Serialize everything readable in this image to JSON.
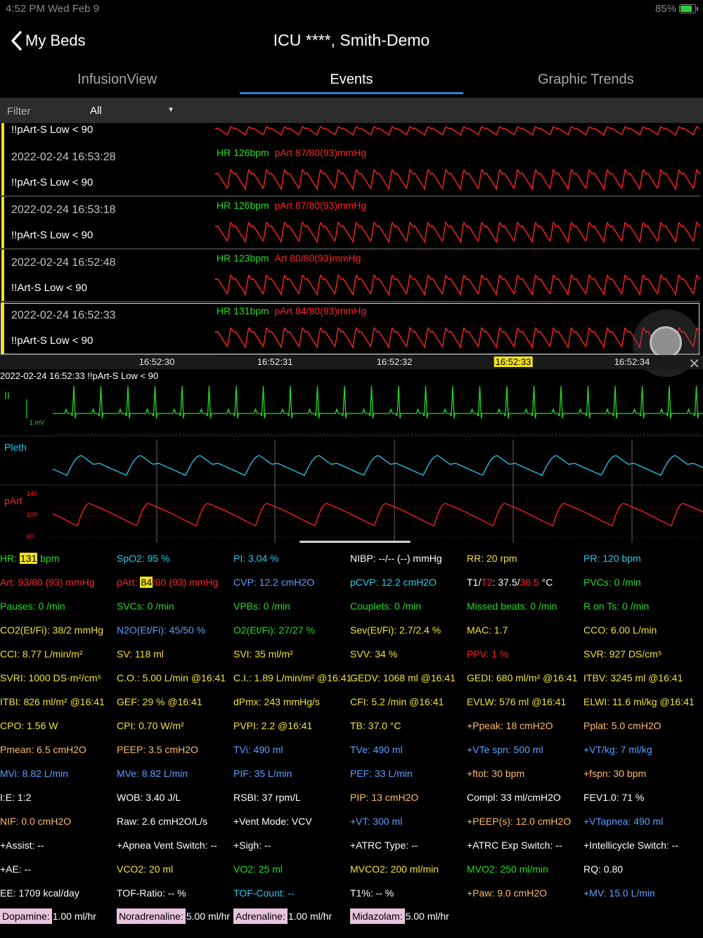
{
  "statusbar": {
    "time": "4:52 PM   Wed Feb 9",
    "battery": "85%"
  },
  "nav": {
    "back_label": "My Beds",
    "title": "ICU  ****, Smith-Demo"
  },
  "tabs": [
    {
      "label": "InfusionView",
      "active": false
    },
    {
      "label": "Events",
      "active": true
    },
    {
      "label": "Graphic Trends",
      "active": false
    }
  ],
  "filter": {
    "label": "Filter",
    "value": "All"
  },
  "events": [
    {
      "timestamp": "",
      "alarm": "!!pArt-S Low < 90",
      "hr": "",
      "pressure": ""
    },
    {
      "timestamp": "2022-02-24 16:53:28",
      "alarm": "!!pArt-S Low < 90",
      "hr": "HR 126bpm",
      "pressure": "pArt 87/80(93)mmHg"
    },
    {
      "timestamp": "2022-02-24 16:53:18",
      "alarm": "!!pArt-S Low < 90",
      "hr": "HR 126bpm",
      "pressure": "pArt 87/80(93)mmHg"
    },
    {
      "timestamp": "2022-02-24 16:52:48",
      "alarm": "!!Art-S Low < 90",
      "hr": "HR 123bpm",
      "pressure": "Art 80/80(93)mmHg"
    },
    {
      "timestamp": "2022-02-24 16:52:33",
      "alarm": "!!pArt-S Low < 90",
      "hr": "HR 131bpm",
      "pressure": "pArt 84/80(93)mmHg"
    }
  ],
  "timeline": {
    "ticks": [
      "16:52:30",
      "16:52:31",
      "16:52:32",
      "16:52:33",
      "16:52:34"
    ],
    "highlighted": "16:52:33"
  },
  "event_caption": "2022-02-24  16:52:33   !!pArt-S Low < 90",
  "waves": {
    "ecg_label": "II",
    "ecg_scale": "1 mV",
    "pleth_label": "Pleth",
    "part_label": "pArt",
    "part_scale": [
      "140",
      "100",
      "60"
    ]
  },
  "params": {
    "rows": [
      [
        [
          "HR: ",
          "131",
          " bpm",
          "g"
        ],
        [
          "SpO2: 95 %",
          "c"
        ],
        [
          "PI: 3.04 %",
          "c"
        ],
        [
          "NIBP: --/-- (--) mmHg",
          "w"
        ],
        [
          "RR: 20 rpm",
          "y"
        ],
        [
          "PR: 120 bpm",
          "c"
        ]
      ],
      [
        [
          "Art: 93/80  (93) mmHg",
          "r"
        ],
        [
          "pArt: ",
          "84",
          "/80  (93) mmHg",
          "r"
        ],
        [
          "CVP: 12.2 cmH2O",
          "b"
        ],
        [
          "pCVP: 12.2 cmH2O",
          "c"
        ],
        [
          "T1/T2: 37.5/36.5 °C",
          "w"
        ],
        [
          "PVCs: 0 /min",
          "g"
        ]
      ],
      [
        [
          "Pauses: 0 /min",
          "g"
        ],
        [
          "SVCs: 0 /min",
          "g"
        ],
        [
          "VPBs: 0 /min",
          "g"
        ],
        [
          "Couplets: 0 /min",
          "g"
        ],
        [
          "Missed beats: 0 /min",
          "g"
        ],
        [
          "R on Ts: 0 /min",
          "g"
        ]
      ],
      [
        [
          "CO2(Et/Fi): 38/2 mmHg",
          "y"
        ],
        [
          "N2O(Et/Fi): 45/50 %",
          "b"
        ],
        [
          "O2(Et/Fi): 27/27 %",
          "g"
        ],
        [
          "Sev(Et/Fi): 2.7/2.4 %",
          "y"
        ],
        [
          "MAC: 1.7",
          "y"
        ],
        [
          "CCO: 6.00 L/min",
          "y"
        ]
      ],
      [
        [
          "CCI: 8.77 L/min/m²",
          "y"
        ],
        [
          "SV: 118 ml",
          "y"
        ],
        [
          "SVI: 35 ml/m²",
          "y"
        ],
        [
          "SVV: 34 %",
          "y"
        ],
        [
          "PPV: 1 %",
          "r"
        ],
        [
          "SVR: 927 DS/cm⁵",
          "y"
        ]
      ],
      [
        [
          "SVRI: 1000 DS·m²/cm⁵",
          "y"
        ],
        [
          "C.O.: 5.00 L/min @16:41",
          "y"
        ],
        [
          "C.I.: 1.89 L/min/m² @16:41",
          "y"
        ],
        [
          "GEDV: 1068 ml @16:41",
          "y"
        ],
        [
          "GEDI: 680 ml/m² @16:41",
          "y"
        ],
        [
          "ITBV: 3245 ml @16:41",
          "y"
        ]
      ],
      [
        [
          "ITBI: 826 ml/m² @16:41",
          "y"
        ],
        [
          "GEF: 29 % @16:41",
          "y"
        ],
        [
          "dPmx: 243 mmHg/s",
          "y"
        ],
        [
          "CFI: 5.2 /min @16:41",
          "y"
        ],
        [
          "EVLW: 576 ml @16:41",
          "y"
        ],
        [
          "ELWI: 11.6 ml/kg @16:41",
          "y"
        ]
      ],
      [
        [
          "CPO: 1.56 W",
          "y"
        ],
        [
          "CPI: 0.70 W/m²",
          "y"
        ],
        [
          "PVPI: 2.2  @16:41",
          "y"
        ],
        [
          "TB: 37.0 °C",
          "y"
        ],
        [
          "+Ppeak: 18 cmH2O",
          "o"
        ],
        [
          "Pplat: 5.0 cmH2O",
          "o"
        ]
      ],
      [
        [
          "Pmean: 6.5 cmH2O",
          "o"
        ],
        [
          "PEEP: 3.5 cmH2O",
          "o"
        ],
        [
          "TVi: 490 ml",
          "b"
        ],
        [
          "TVe: 490 ml",
          "b"
        ],
        [
          "+VTe spn: 500 ml",
          "b"
        ],
        [
          "+VT/kg: 7 ml/kg",
          "b"
        ]
      ],
      [
        [
          "MVi: 8.82 L/min",
          "b"
        ],
        [
          "MVe: 8.82 L/min",
          "b"
        ],
        [
          "PIF: 35 L/min",
          "b"
        ],
        [
          "PEF: 33 L/min",
          "b"
        ],
        [
          "+ftot: 30 bpm",
          "o"
        ],
        [
          "+fspn: 30 bpm",
          "o"
        ]
      ],
      [
        [
          "I:E: 1:2",
          "w"
        ],
        [
          "WOB: 3.40 J/L",
          "w"
        ],
        [
          "RSBI: 37 rpm/L",
          "w"
        ],
        [
          "PIP: 13 cmH2O",
          "o"
        ],
        [
          "Compl: 33 ml/cmH2O",
          "w"
        ],
        [
          "FEV1.0: 71 %",
          "w"
        ]
      ],
      [
        [
          "NIF: 0.0 cmH2O",
          "o"
        ],
        [
          "Raw: 2.6 cmH2O/L/s",
          "w"
        ],
        [
          "+Vent Mode: VCV",
          "w"
        ],
        [
          "+VT: 300 ml",
          "b"
        ],
        [
          "+PEEP(s): 12.0 cmH2O",
          "o"
        ],
        [
          "+VTapnea: 490 ml",
          "b"
        ]
      ],
      [
        [
          "+Assist: --",
          "w"
        ],
        [
          "+Apnea Vent Switch: --",
          "w"
        ],
        [
          "+Sigh: --",
          "w"
        ],
        [
          "+ATRC Type: --",
          "w"
        ],
        [
          "+ATRC Exp Switch: --",
          "w"
        ],
        [
          "+Intellicycle Switch: --",
          "w"
        ]
      ],
      [
        [
          "+AE: --",
          "w"
        ],
        [
          "VCO2: 20 ml",
          "y"
        ],
        [
          "VO2: 25 ml",
          "g"
        ],
        [
          "MVCO2: 200 ml/min",
          "y"
        ],
        [
          "MVO2: 250 ml/min",
          "g"
        ],
        [
          "RQ: 0.80",
          "w"
        ]
      ],
      [
        [
          "EE: 1709 kcal/day",
          "w"
        ],
        [
          "TOF-Ratio: -- %",
          "w"
        ],
        [
          "TOF-Count: --",
          "c"
        ],
        [
          "T1%: -- %",
          "w"
        ],
        [
          "+Paw: 9.0 cmH2O",
          "o"
        ],
        [
          "+MV: 15.0 L/min",
          "b"
        ]
      ]
    ],
    "drugs": [
      {
        "name": "Dopamine:",
        "value": "1.00 ml/hr"
      },
      {
        "name": "Noradrenaline:",
        "value": "5.00 ml/hr"
      },
      {
        "name": "Adrenaline:",
        "value": "1.00 ml/hr"
      },
      {
        "name": "Midazolam:",
        "value": "5.00 ml/hr"
      }
    ]
  },
  "colors": {
    "ecg": "#22dd22",
    "pleth": "#22ccee",
    "art": "#ff2222",
    "highlight": "#f1e21a",
    "tab_underline": "#2f7fd0"
  }
}
